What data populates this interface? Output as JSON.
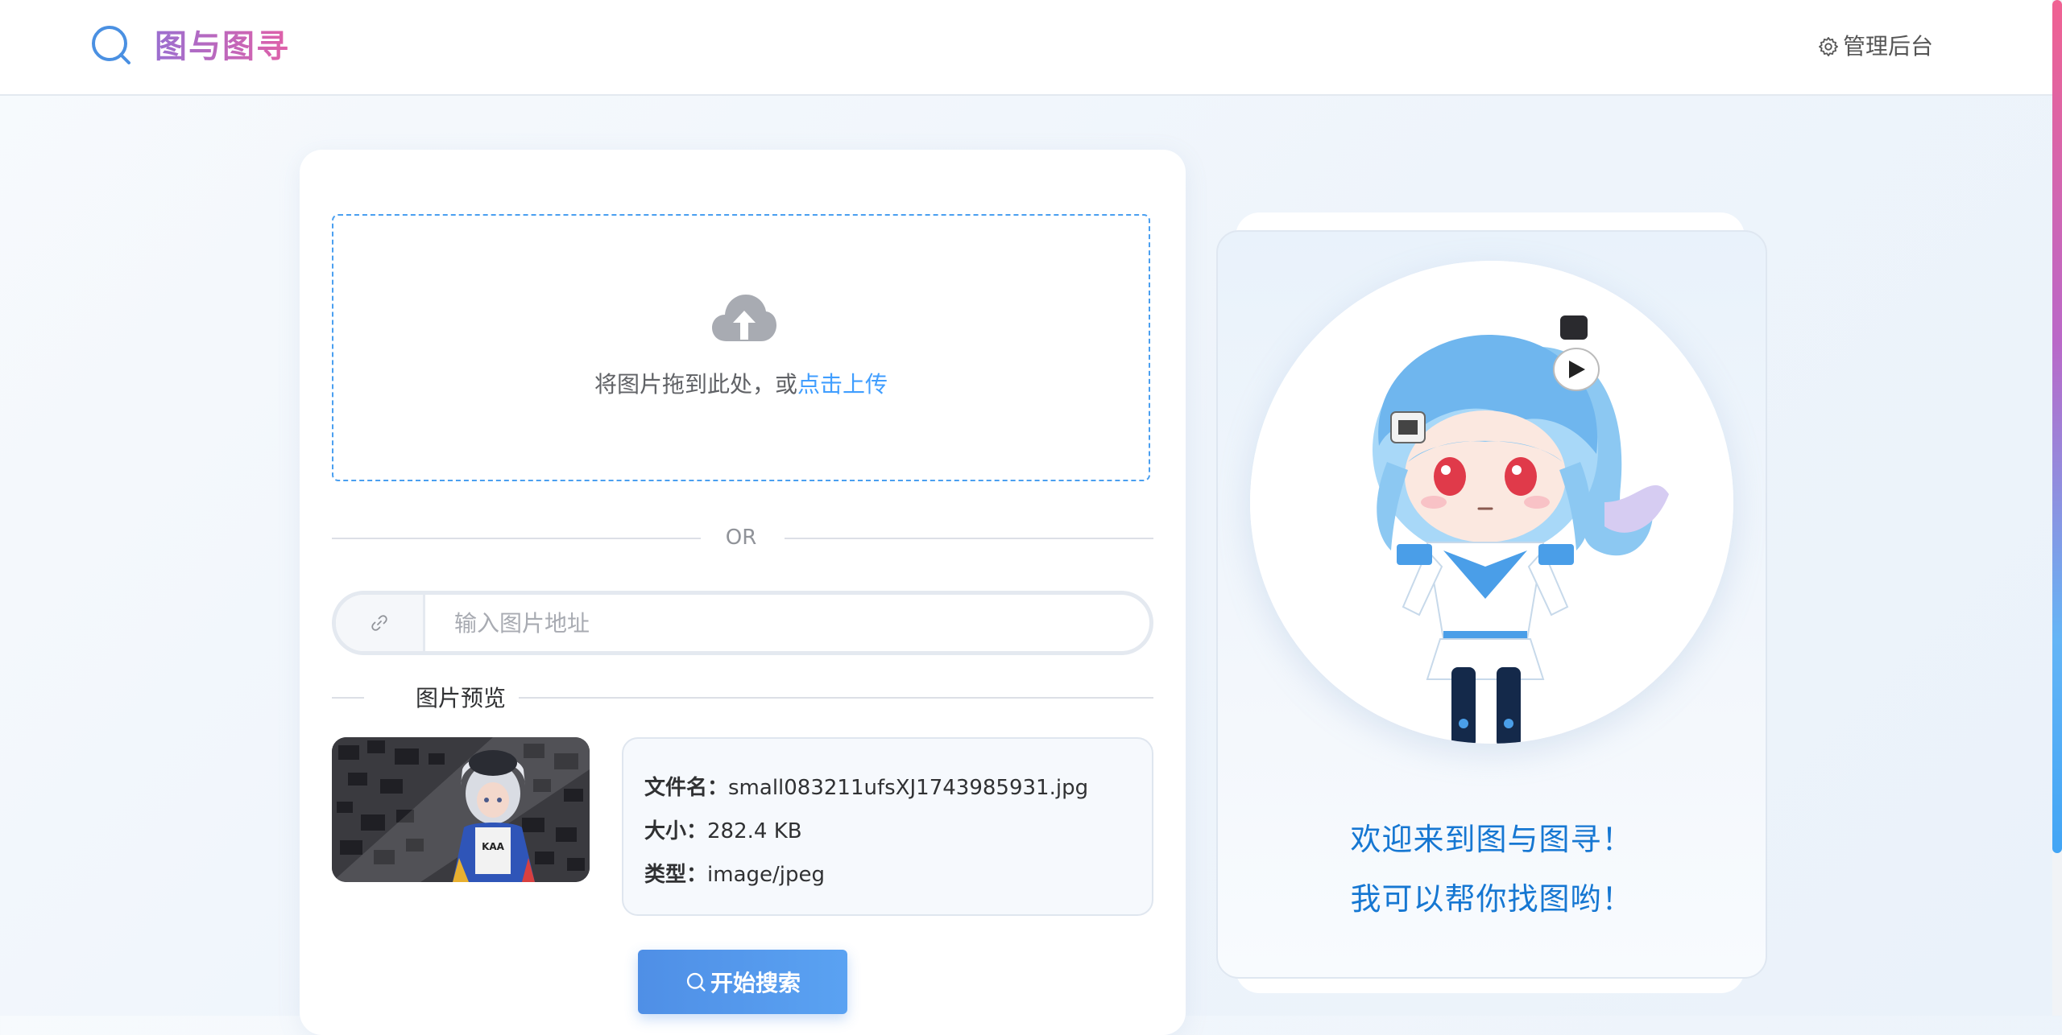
{
  "header": {
    "logo_icon": "search-icon",
    "brand": "图与图寻",
    "admin_icon": "gear-icon",
    "admin_label": "管理后台"
  },
  "upload": {
    "icon": "cloud-upload-icon",
    "prompt": "将图片拖到此处，或",
    "link": "点击上传"
  },
  "divider": {
    "or": "OR"
  },
  "url_input": {
    "icon": "link-icon",
    "placeholder": "输入图片地址",
    "value": ""
  },
  "preview": {
    "title": "图片预览",
    "filename_label": "文件名：",
    "filename": "small083211ufsXJ1743985931.jpg",
    "size_label": "大小：",
    "size": "282.4 KB",
    "type_label": "类型：",
    "type": "image/jpeg"
  },
  "search_button": {
    "icon": "search-icon",
    "label": "开始搜索"
  },
  "welcome": {
    "line1": "欢迎来到图与图寻！",
    "line2": "我可以帮你找图哟！"
  },
  "colors": {
    "accent": "#409eff",
    "brand_gradient_start": "#9b6fd0",
    "brand_gradient_end": "#e060a8",
    "welcome_text": "#1677d2"
  }
}
